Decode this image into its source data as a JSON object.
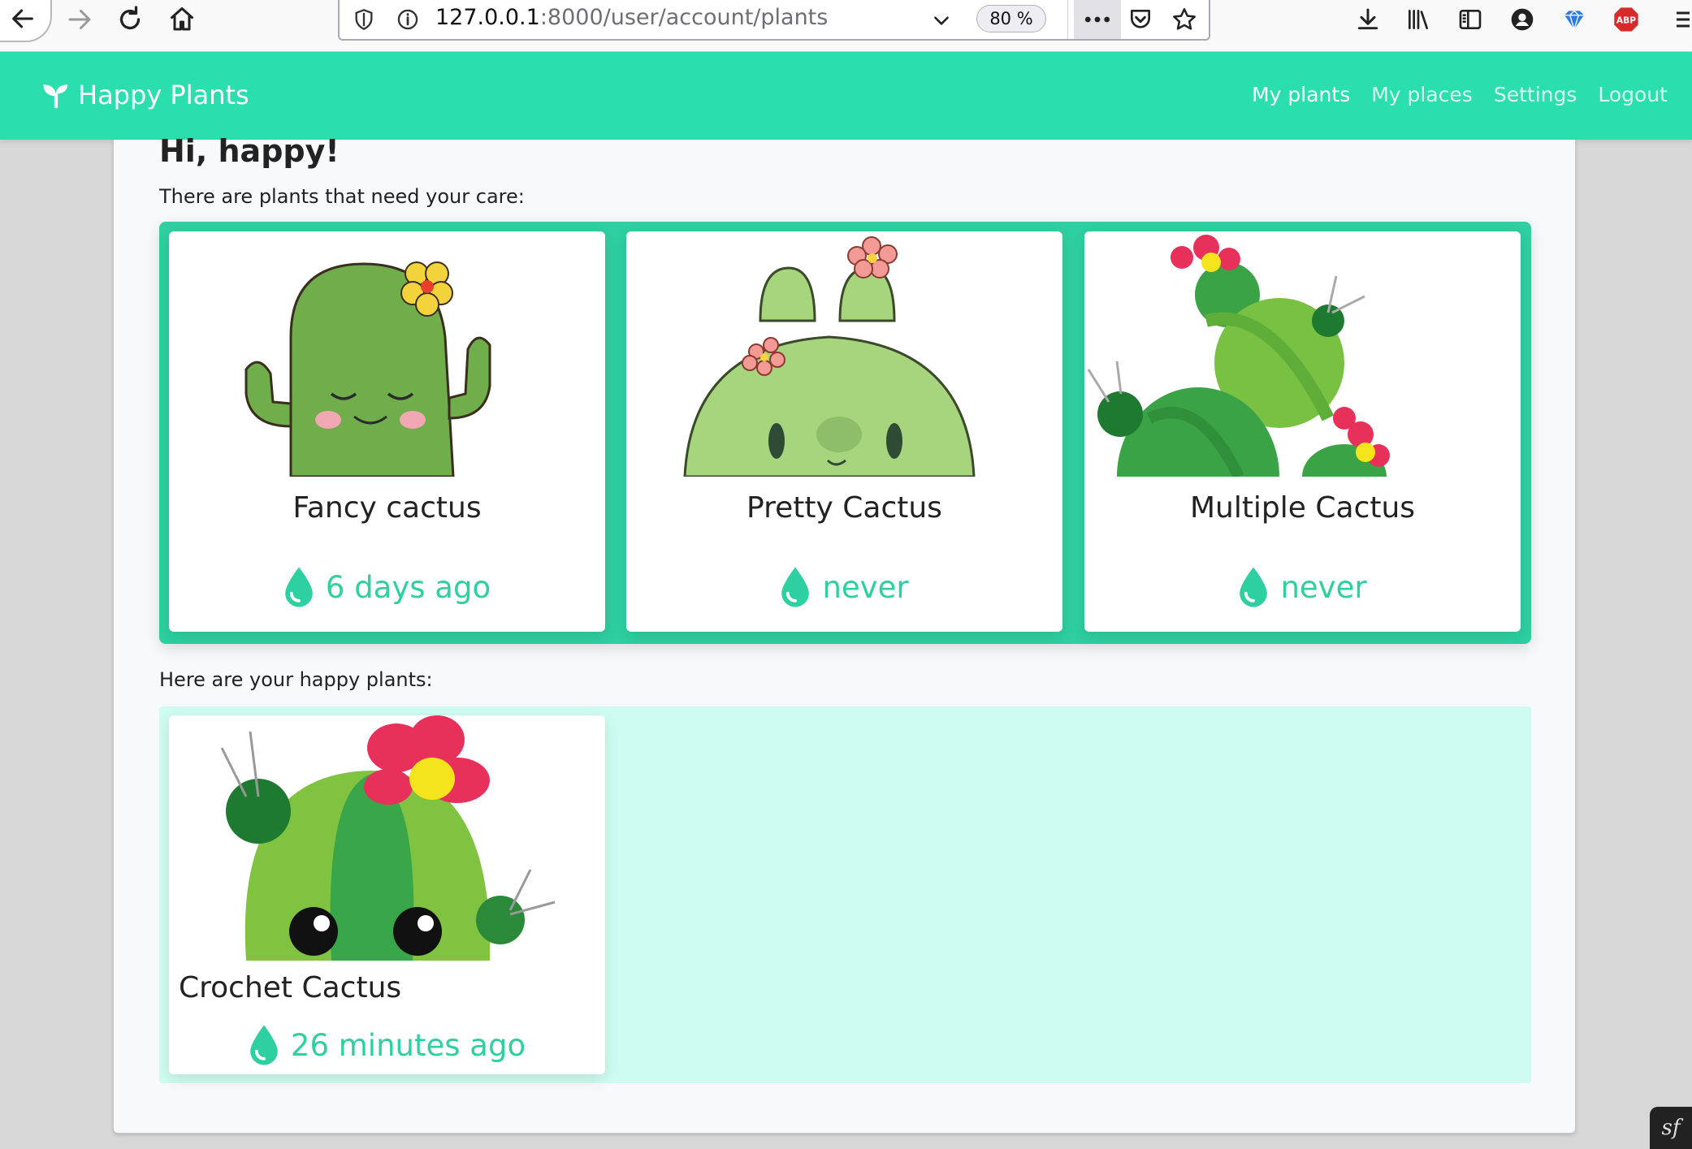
{
  "browser": {
    "url_host": "127.0.0.1",
    "url_rest": ":8000/user/account/plants",
    "zoom": "80 %"
  },
  "app": {
    "brand": "Happy Plants",
    "nav": {
      "my_plants": "My plants",
      "my_places": "My places",
      "settings": "Settings",
      "logout": "Logout"
    }
  },
  "page": {
    "greeting": "Hi, happy!",
    "care_label": "There are plants that need your care:",
    "happy_label": "Here are your happy plants:"
  },
  "care_plants": [
    {
      "name": "Fancy cactus",
      "watered": "6 days ago"
    },
    {
      "name": "Pretty Cactus",
      "watered": "never"
    },
    {
      "name": "Multiple Cactus",
      "watered": "never"
    }
  ],
  "happy_plants": [
    {
      "name": "Crochet Cactus",
      "watered": "26 minutes ago"
    }
  ],
  "colors": {
    "accent": "#2adead",
    "care_box": "#2ecfa0",
    "happy_box": "#cffcf0"
  },
  "icons": [
    "back-arrow-icon",
    "forward-arrow-icon",
    "reload-icon",
    "home-icon",
    "shield-icon",
    "info-icon",
    "chevron-down-icon",
    "more-icon",
    "pocket-icon",
    "star-icon",
    "download-icon",
    "library-icon",
    "sidebar-icon",
    "account-icon",
    "extension-icon",
    "adblock-icon",
    "menu-icon",
    "leaf-icon",
    "water-drop-icon",
    "symfony-icon"
  ],
  "toolbar": {
    "adblock_label": "ABP"
  },
  "symfony_badge": "sf"
}
